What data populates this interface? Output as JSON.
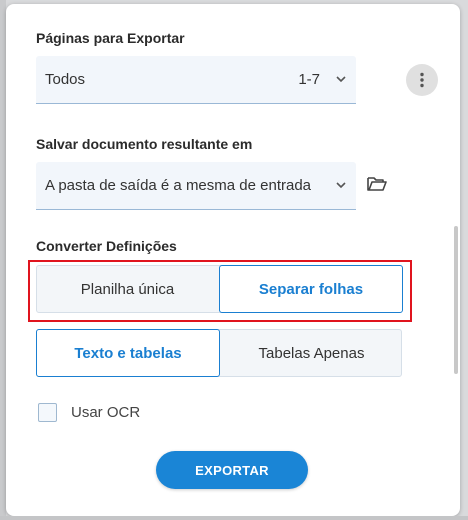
{
  "pages_section": {
    "label": "Páginas para Exportar",
    "select_value": "Todos",
    "range": "1-7",
    "chevron_icon": "chevron-down-icon",
    "more_icon": "more-vertical-icon"
  },
  "save_section": {
    "label": "Salvar documento resultante em",
    "select_value": "A pasta de saída é a mesma de entrada",
    "chevron_icon": "chevron-down-icon",
    "folder_icon": "folder-open-icon"
  },
  "convert_section": {
    "label": "Converter Definições",
    "sheet_options": [
      {
        "label": "Planilha única",
        "active": false
      },
      {
        "label": "Separar folhas",
        "active": true
      }
    ],
    "content_options": [
      {
        "label": "Texto e tabelas",
        "active": true
      },
      {
        "label": "Tabelas Apenas",
        "active": false
      }
    ],
    "ocr_label": "Usar OCR",
    "ocr_checked": false
  },
  "export_button": "EXPORTAR",
  "colors": {
    "accent": "#1a85d6",
    "highlight": "#e0141e",
    "field_bg": "#f2f6fb"
  }
}
